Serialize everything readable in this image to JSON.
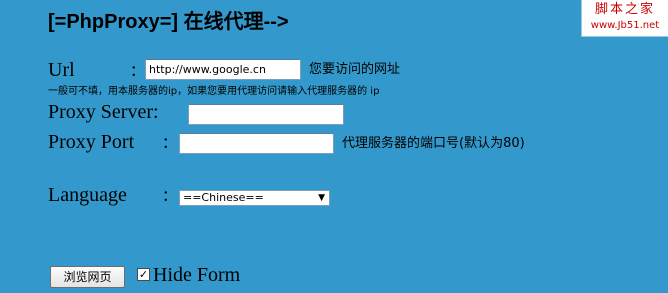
{
  "header": {
    "title": "[=PhpProxy=] 在线代理-->"
  },
  "watermark": {
    "line1": "脚本之家",
    "line2": "www.Jb51.net"
  },
  "form": {
    "url": {
      "label": "Url",
      "colon": ":",
      "value": "http://www.google.cn",
      "hint": "您要访问的网址",
      "note": "一般可不填，用本服务器的ip，如果您要用代理访问请输入代理服务器的 ip"
    },
    "proxy_server": {
      "label": "Proxy Server:",
      "value": ""
    },
    "proxy_port": {
      "label": "Proxy Port",
      "colon": ":",
      "value": "",
      "hint": "代理服务器的端口号(默认为80)"
    },
    "language": {
      "label": "Language",
      "colon": ":",
      "selected": "==Chinese=="
    },
    "submit_label": "浏览网页",
    "hide_form": {
      "label": "Hide Form",
      "checked": true,
      "check_glyph": "✓"
    }
  }
}
